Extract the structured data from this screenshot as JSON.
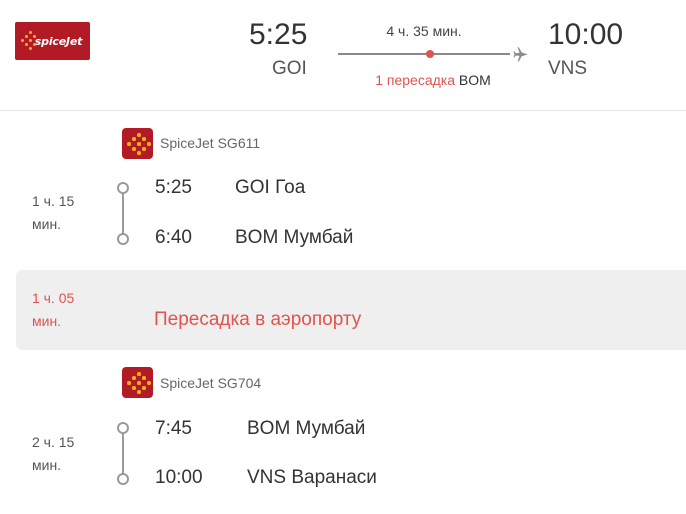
{
  "header": {
    "logo_text": "spiceJet",
    "depart_time": "5:25",
    "depart_code": "GOI",
    "duration": "4 ч. 35 мин.",
    "transfer_count": "1 пересадка",
    "transfer_airport": "BOM",
    "arrive_time": "10:00",
    "arrive_code": "VNS",
    "icons": [
      "plane-icon"
    ]
  },
  "segments": [
    {
      "airline": "SpiceJet SG611",
      "duration": "1 ч. 15 мин.",
      "stops": [
        {
          "time": "5:25",
          "place": "GOI Гоа"
        },
        {
          "time": "6:40",
          "place": "BOM Мумбай"
        }
      ]
    },
    {
      "airline": "SpiceJet SG704",
      "duration": "2 ч. 15 мин.",
      "stops": [
        {
          "time": "7:45",
          "place": "BOM Мумбай"
        },
        {
          "time": "10:00",
          "place": "VNS Варанаси"
        }
      ]
    }
  ],
  "layover": {
    "duration": "1 ч. 05 мин.",
    "text": "Пересадка в аэропорту"
  },
  "colors": {
    "brand": "#b21a25",
    "brand_dots": "#f2b21d",
    "accent_red": "#e0534f",
    "layover_bg": "#efefef"
  }
}
